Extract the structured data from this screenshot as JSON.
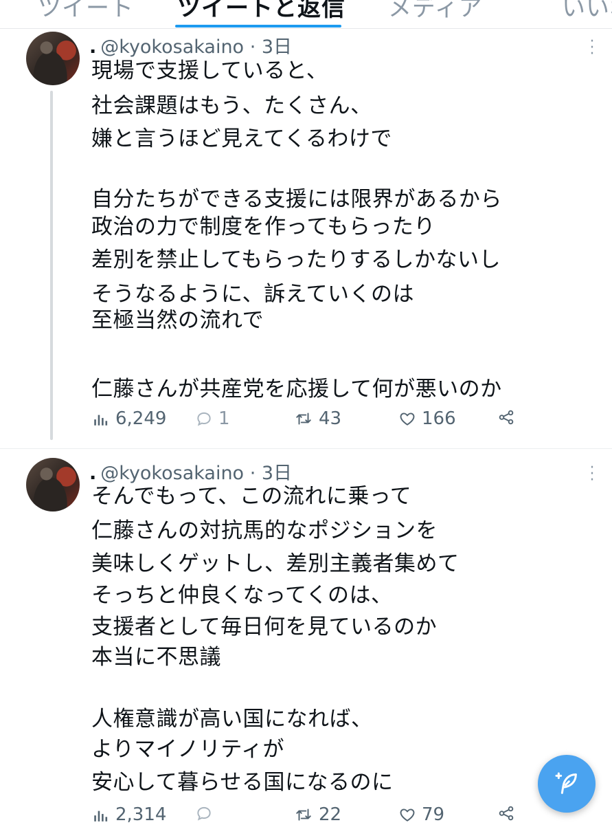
{
  "tabs": {
    "items": [
      "ツイート",
      "ツイートと返信",
      "メディア",
      "いいね"
    ],
    "active_index": 1
  },
  "tweets": [
    {
      "display_name": ".",
      "handle": "@kyokosakaino",
      "time": "· 3日",
      "lines": [
        "現場で支援していると、",
        "社会課題はもう、たくさん、",
        "嫌と言うほど見えてくるわけで",
        "",
        "自分たちができる支援には限界があるから",
        "政治の力で制度を作ってもらったり",
        "差別を禁止してもらったりするしかないし",
        "そうなるように、訴えていくのは",
        "至極当然の流れで",
        "",
        "仁藤さんが共産党を応援して何が悪いのか"
      ],
      "views": "6,249",
      "replies": "1",
      "retweets": "43",
      "likes": "166"
    },
    {
      "display_name": ".",
      "handle": "@kyokosakaino",
      "time": "· 3日",
      "lines": [
        "そんでもって、この流れに乗って",
        "仁藤さんの対抗馬的なポジションを",
        "美味しくゲットし、差別主義者集めて",
        "そっちと仲良くなってくのは、",
        "支援者として毎日何を見ているのか",
        "本当に不思議",
        "",
        "人権意識が高い国になれば、",
        "よりマイノリティが",
        "安心して暮らせる国になるのに"
      ],
      "views": "2,314",
      "replies": "",
      "retweets": "22",
      "likes": "79"
    }
  ],
  "icons": {
    "views": "bar-chart-icon",
    "reply": "speech-bubble-icon",
    "retweet": "retweet-icon",
    "like": "heart-icon",
    "share": "share-icon",
    "more": "vertical-dots-icon",
    "compose": "feather-plus-icon"
  },
  "colors": {
    "accent": "#1d9bf0",
    "fab": "#4aa3f0",
    "text": "#0f1419",
    "muted": "#536471"
  }
}
